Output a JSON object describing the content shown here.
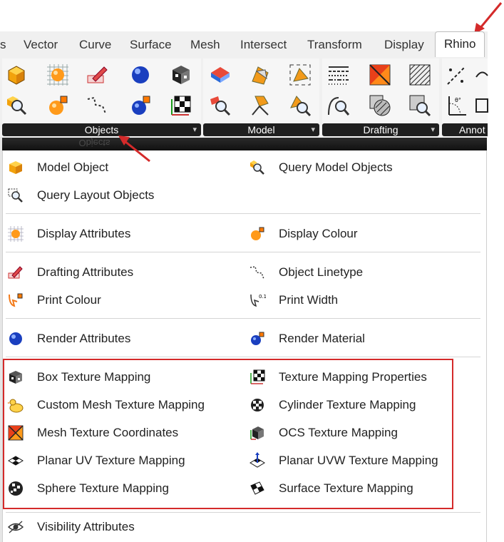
{
  "tabs": [
    {
      "label": "s"
    },
    {
      "label": "Vector"
    },
    {
      "label": "Curve"
    },
    {
      "label": "Surface"
    },
    {
      "label": "Mesh"
    },
    {
      "label": "Intersect"
    },
    {
      "label": "Transform"
    },
    {
      "label": "Display"
    },
    {
      "label": "Rhino"
    }
  ],
  "panels": {
    "objects": "Objects",
    "model": "Model",
    "drafting": "Drafting",
    "annot": "Annot"
  },
  "ghost_label": "Objects",
  "menu": {
    "model_object": "Model Object",
    "query_model_objects": "Query Model Objects",
    "query_layout_objects": "Query Layout Objects",
    "display_attributes": "Display Attributes",
    "display_colour": "Display Colour",
    "drafting_attributes": "Drafting Attributes",
    "object_linetype": "Object Linetype",
    "print_colour": "Print Colour",
    "print_width": "Print Width",
    "render_attributes": "Render Attributes",
    "render_material": "Render Material",
    "box_texture_mapping": "Box Texture Mapping",
    "texture_mapping_properties": "Texture Mapping Properties",
    "custom_mesh_texture_mapping": "Custom Mesh Texture Mapping",
    "cylinder_texture_mapping": "Cylinder Texture Mapping",
    "mesh_texture_coordinates": "Mesh Texture Coordinates",
    "ocs_texture_mapping": "OCS Texture Mapping",
    "planar_uv_texture_mapping": "Planar UV Texture Mapping",
    "planar_uvw_texture_mapping": "Planar UVW Texture Mapping",
    "sphere_texture_mapping": "Sphere Texture Mapping",
    "surface_texture_mapping": "Surface Texture Mapping",
    "visibility_attributes": "Visibility Attributes"
  },
  "colors": {
    "highlight_box": "#d42a2a",
    "arrow": "#d42a2a",
    "panel_footer": "#1f1f1f"
  }
}
